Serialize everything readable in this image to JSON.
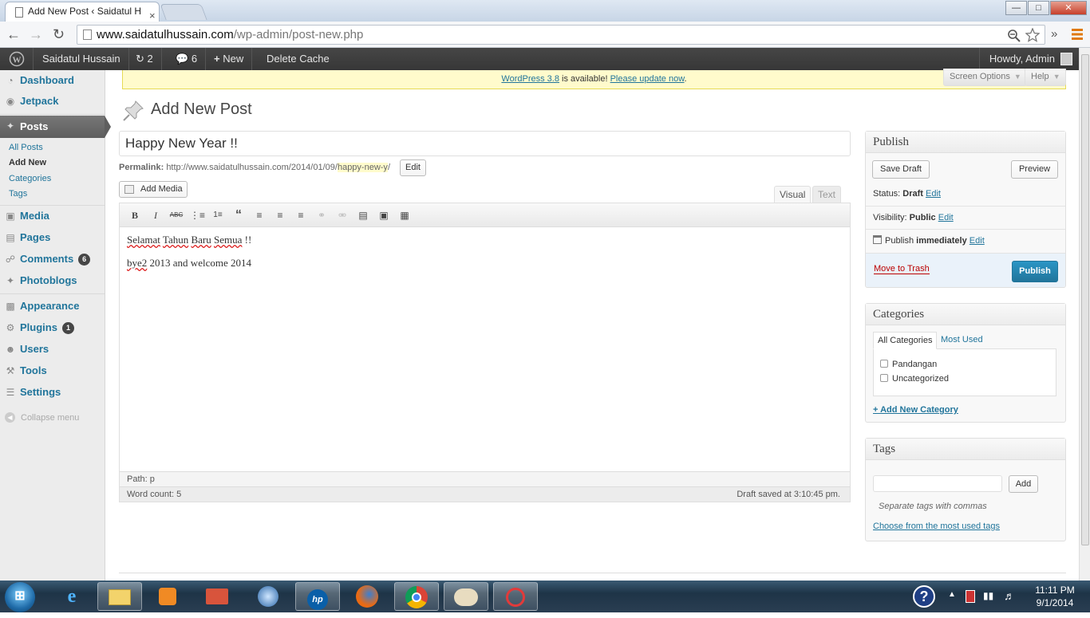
{
  "browser": {
    "tab_title": "Add New Post ‹ Saidatul H",
    "tab_close": "×",
    "url_host": "www.saidatulhussain.com",
    "url_path": "/wp-admin/post-new.php",
    "menu_glyph": "»",
    "win_min": "—",
    "win_max": "□",
    "win_close": "✕"
  },
  "adminbar": {
    "site_name": "Saidatul Hussain",
    "updates_count": "2",
    "comments_count": "6",
    "new_label": "New",
    "delete_cache": "Delete Cache",
    "howdy": "Howdy, Admin"
  },
  "sidebar": {
    "dashboard": "Dashboard",
    "jetpack": "Jetpack",
    "posts": "Posts",
    "posts_sub": [
      "All Posts",
      "Add New",
      "Categories",
      "Tags"
    ],
    "media": "Media",
    "pages": "Pages",
    "comments": "Comments",
    "comments_bubble": "6",
    "photoblogs": "Photoblogs",
    "appearance": "Appearance",
    "plugins": "Plugins",
    "plugins_bubble": "1",
    "users": "Users",
    "tools": "Tools",
    "settings": "Settings",
    "collapse": "Collapse menu"
  },
  "notice": {
    "link1": "WordPress 3.8",
    "middle": " is available! ",
    "link2": "Please update now",
    "end": "."
  },
  "screen_options": "Screen Options",
  "help": "Help",
  "page_title": "Add New Post",
  "post": {
    "title": "Happy New Year !!",
    "permalink_label": "Permalink:",
    "permalink_base": "http://www.saidatulhussain.com/2014/01/09/",
    "permalink_slug": "happy-new-y",
    "permalink_end": "/",
    "edit_btn": "Edit",
    "add_media": "Add Media",
    "tab_visual": "Visual",
    "tab_text": "Text",
    "line1_words": [
      "Selamat",
      "Tahun",
      "Baru",
      "Semua"
    ],
    "line1_end": "!!",
    "line2_word": "bye2",
    "line2_rest": " 2013 and welcome 2014",
    "path": "Path: p",
    "word_count": "Word count: 5",
    "draft_saved": "Draft saved at 3:10:45 pm."
  },
  "toolbar_icons": [
    "bold-icon",
    "italic-icon",
    "strikethrough-icon",
    "bullet-list-icon",
    "numbered-list-icon",
    "blockquote-icon",
    "align-left-icon",
    "align-center-icon",
    "align-right-icon",
    "link-icon",
    "unlink-icon",
    "more-tag-icon",
    "fullscreen-icon",
    "kitchen-sink-icon"
  ],
  "publish": {
    "heading": "Publish",
    "save_draft": "Save Draft",
    "preview": "Preview",
    "status_label": "Status: ",
    "status_value": "Draft",
    "visibility_label": "Visibility: ",
    "visibility_value": "Public",
    "publish_label": "Publish ",
    "publish_value": "immediately",
    "edit": "Edit",
    "trash": "Move to Trash",
    "publish_btn": "Publish"
  },
  "categories": {
    "heading": "Categories",
    "tab_all": "All Categories",
    "tab_most": "Most Used",
    "items": [
      "Pandangan",
      "Uncategorized"
    ],
    "add_new": "+ Add New Category"
  },
  "tags": {
    "heading": "Tags",
    "add_btn": "Add",
    "hint": "Separate tags with commas",
    "choose": "Choose from the most used tags"
  },
  "taskbar": {
    "time": "11:11 PM",
    "date": "9/1/2014"
  },
  "colors": {
    "admin_bar": "#464646",
    "link": "#21759b",
    "publish_button": "#21759b",
    "notice_bg": "#fffbcc"
  }
}
